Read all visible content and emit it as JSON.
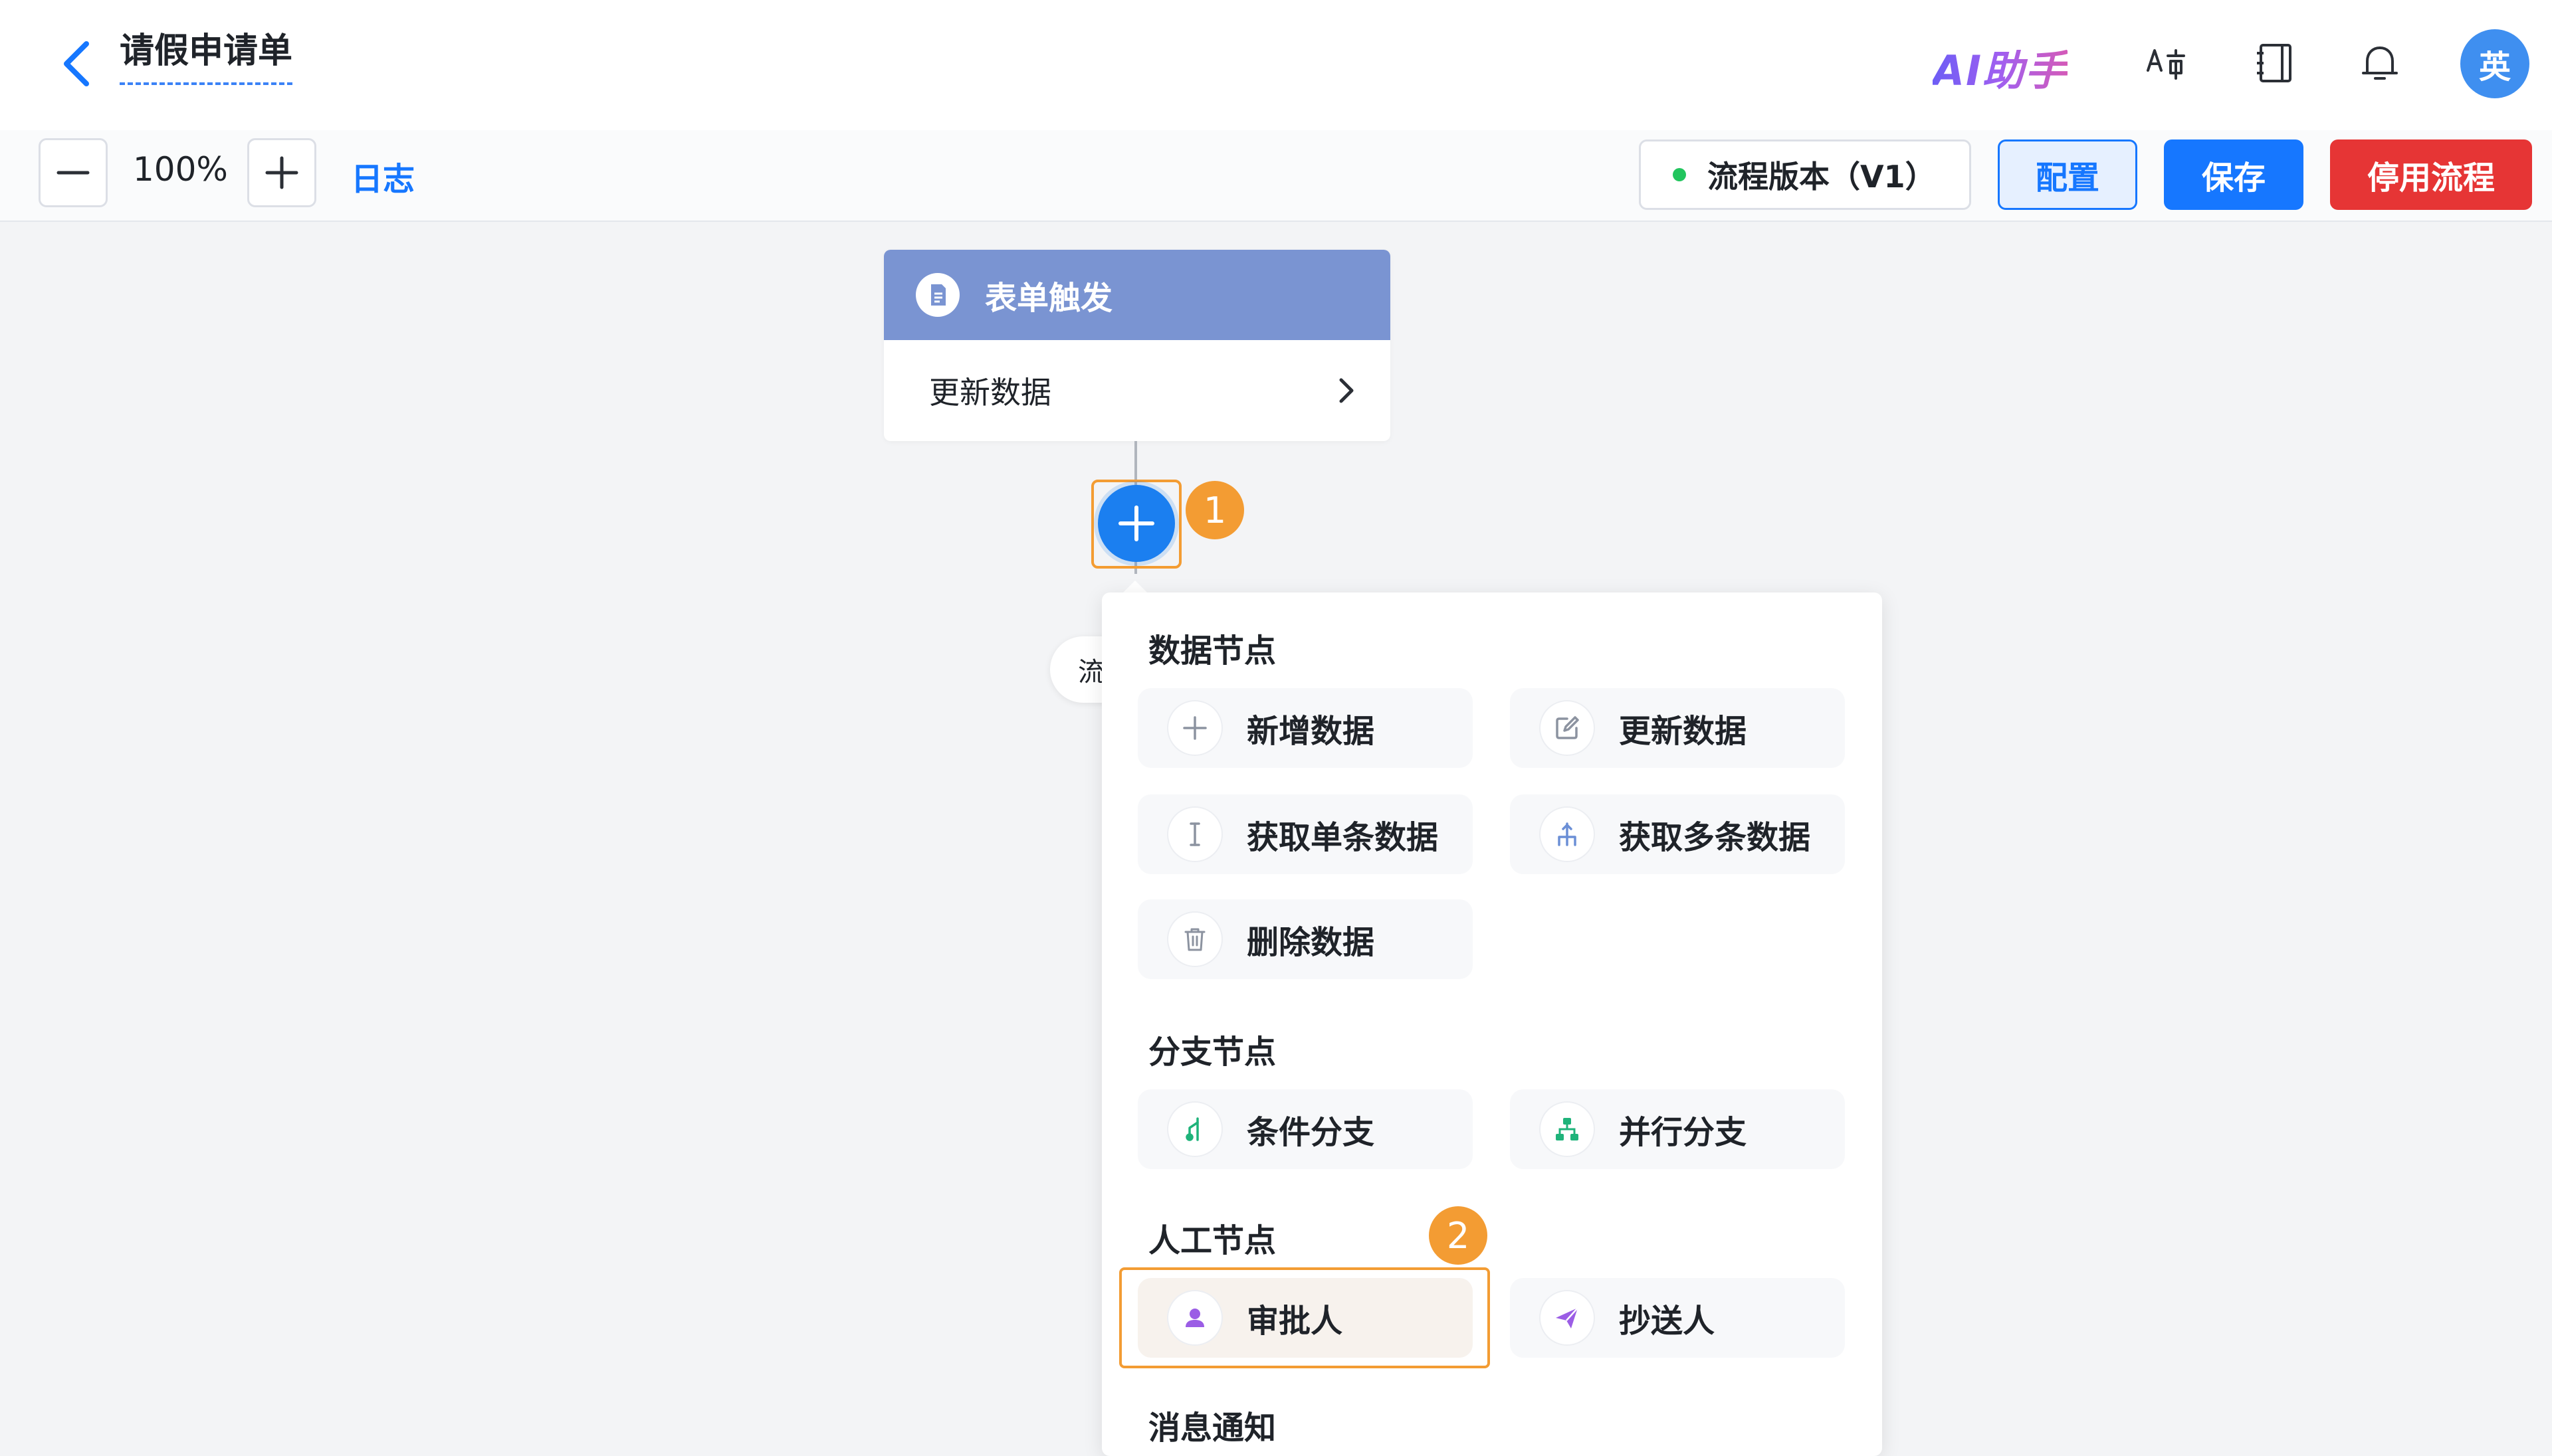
{
  "header": {
    "title": "请假申请单",
    "ai_assistant": "AI助手",
    "avatar_text": "英"
  },
  "toolbar": {
    "zoom_level": "100%",
    "log_label": "日志",
    "version_label": "流程版本（V1）",
    "config_label": "配置",
    "save_label": "保存",
    "disable_label": "停用流程"
  },
  "trigger": {
    "title": "表单触发",
    "action": "更新数据"
  },
  "markers": [
    "1",
    "2"
  ],
  "hidden_node_text": "流",
  "panel": {
    "sections": [
      {
        "title": "数据节点"
      },
      {
        "title": "分支节点"
      },
      {
        "title": "人工节点"
      },
      {
        "title": "消息通知"
      }
    ],
    "data_items": [
      "新增数据",
      "更新数据",
      "获取单条数据",
      "获取多条数据",
      "删除数据"
    ],
    "branch_items": [
      "条件分支",
      "并行分支"
    ],
    "manual_items": [
      "审批人",
      "抄送人"
    ]
  },
  "colors": {
    "accent": "#1677ff",
    "danger": "#e63535",
    "trigger_header": "#7a94d2",
    "highlight": "#f39c33",
    "branch_icon": "#1fb37a",
    "manual_icon": "#9b5de5"
  }
}
